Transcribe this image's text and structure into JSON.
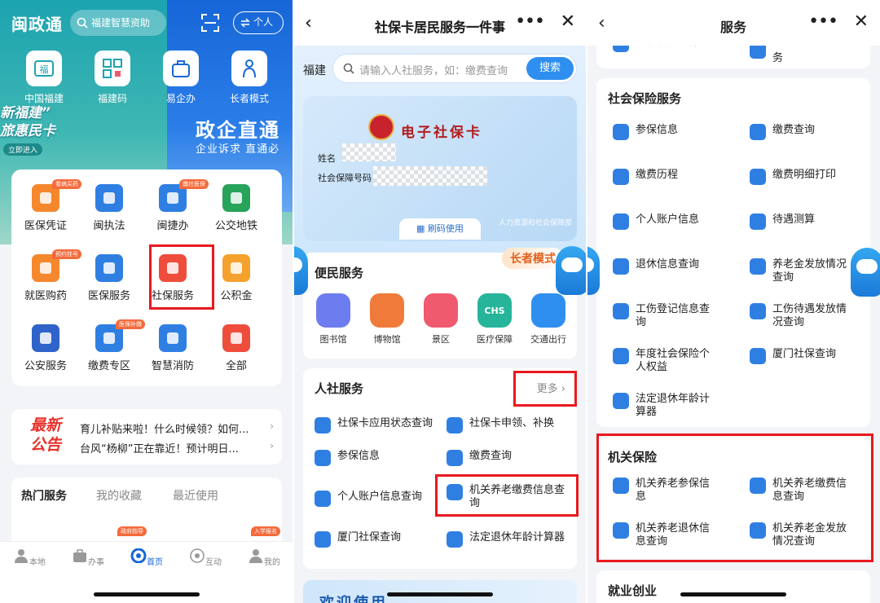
{
  "home": {
    "logo": "闽政通",
    "search_placeholder": "福建智慧资助",
    "user_label": "个人",
    "quick": [
      {
        "label": "中国福建"
      },
      {
        "label": "福建码"
      },
      {
        "label": "易企办"
      },
      {
        "label": "长者模式"
      }
    ],
    "banner_left": "新福建”\n旅惠民卡",
    "banner_btn": "立即进入",
    "banner_right": "政企直通",
    "banner_right_sub": "企业诉求 直通必",
    "grid": [
      {
        "label": "医保凭证",
        "tag": "看病买药",
        "color": "#f5872d"
      },
      {
        "label": "闽执法",
        "tag": "",
        "color": "#2f7fe3"
      },
      {
        "label": "闽捷办",
        "tag": "缴社医保",
        "color": "#2f7fe3"
      },
      {
        "label": "公交地铁",
        "tag": "",
        "color": "#27a35a"
      },
      {
        "label": "就医购药",
        "tag": "预约挂号",
        "color": "#f5872d"
      },
      {
        "label": "医保服务",
        "tag": "",
        "color": "#2f7fe3"
      },
      {
        "label": "社保服务",
        "tag": "",
        "color": "#ef4d3c"
      },
      {
        "label": "公积金",
        "tag": "",
        "color": "#f5a12d"
      },
      {
        "label": "公安服务",
        "tag": "",
        "color": "#2f63c9"
      },
      {
        "label": "缴费专区",
        "tag": "医保补缴",
        "color": "#2f7fe3"
      },
      {
        "label": "智慧消防",
        "tag": "",
        "color": "#2f7fe3"
      },
      {
        "label": "全部",
        "tag": "",
        "color": "#ef4d3c"
      }
    ],
    "news_logo_1": "最新",
    "news_logo_2": "公告",
    "news": [
      "育儿补贴来啦！什么时候领？如何...",
      "台风“杨柳”正在靠近！预计明日..."
    ],
    "hot_tabs": [
      "热门服务",
      "我的收藏",
      "最近使用"
    ],
    "hot_tags": [
      "政府指导",
      "入学报名"
    ],
    "tabbar": [
      "本地",
      "办事",
      "首页",
      "互动",
      "我的"
    ]
  },
  "sbk": {
    "title": "社保卡居民服务一件事",
    "region": "福建",
    "search_placeholder": "请输入人社服务，如：缴费查询",
    "search_btn": "搜索",
    "card_title": "电子社保卡",
    "name_label": "姓名",
    "id_label": "社会保障号码",
    "card_btn": "刷码使用",
    "card_org": "人力资源和社会保障部",
    "elder": "长者模式",
    "bm_title": "便民服务",
    "bm": [
      {
        "label": "图书馆",
        "color": "#6d7df0"
      },
      {
        "label": "博物馆",
        "color": "#f07a3a"
      },
      {
        "label": "景区",
        "color": "#ef5a6f"
      },
      {
        "label": "医疗保障",
        "color": "#26b59a",
        "text": "CHS"
      },
      {
        "label": "交通出行",
        "color": "#2f8ff0"
      }
    ],
    "rs_title": "人社服务",
    "more": "更多",
    "rs": [
      "社保卡应用状态查询",
      "社保卡申领、补换",
      "参保信息",
      "缴费查询",
      "个人账户信息查询",
      "机关养老缴费信息查询",
      "厦门社保查询",
      "法定退休年龄计算器"
    ],
    "welcome": "欢迎使用"
  },
  "svc": {
    "title": "服务",
    "top": [
      "天联福建医保",
      "务"
    ],
    "sb_title": "社会保险服务",
    "sb": [
      "参保信息",
      "缴费查询",
      "缴费历程",
      "缴费明细打印",
      "个人账户信息",
      "待遇测算",
      "退休信息查询",
      "养老金发放情况查询",
      "工伤登记信息查询",
      "工伤待遇发放情况查询",
      "年度社会保险个人权益",
      "厦门社保查询",
      "法定退休年龄计算器"
    ],
    "jg_title": "机关保险",
    "jg": [
      "机关养老参保信息",
      "机关养老缴费信息查询",
      "机关养老退休信息查询",
      "机关养老金发放情况查询"
    ],
    "jy_title": "就业创业"
  }
}
